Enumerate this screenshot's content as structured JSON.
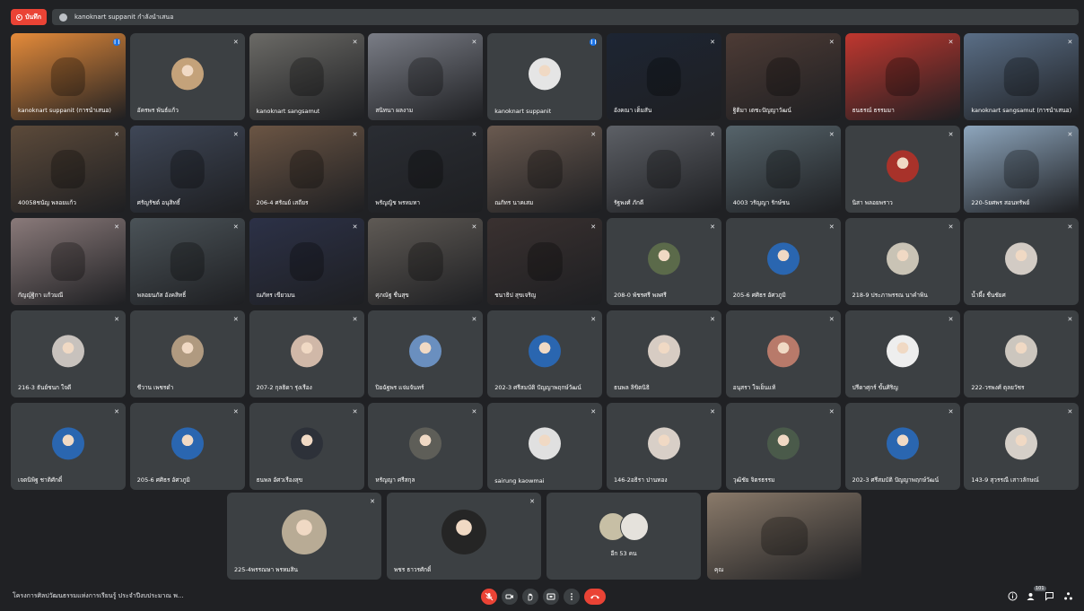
{
  "top": {
    "rec_label": "บันทึก",
    "presenting_text": "kanoknart suppanit กำลังนำเสนอ"
  },
  "tiles": [
    {
      "name": "kanoknart suppanit (การนำเสนอ)",
      "mic": "speaking",
      "kind": "video",
      "color": "#e58b3a"
    },
    {
      "name": "อัครพร พันธ์แก้ว",
      "mic": "muted",
      "kind": "avatar",
      "color": "#c4a27a"
    },
    {
      "name": "kanoknart sangsamut",
      "mic": "muted",
      "kind": "video",
      "color": "#6b6a66"
    },
    {
      "name": "สนิทนา ผลงาม",
      "mic": "muted",
      "kind": "video",
      "color": "#7a7d86"
    },
    {
      "name": "kanoknart suppanit",
      "mic": "speaking",
      "kind": "avatar",
      "color": "#e5e5e5"
    },
    {
      "name": "อังคณา เต็มสัน",
      "mic": "muted",
      "kind": "video",
      "color": "#1d2533"
    },
    {
      "name": "ฐิติมา เตชะปัญญาวัฒน์",
      "mic": "muted",
      "kind": "video",
      "color": "#4d3b35"
    },
    {
      "name": "ธนธรณ์ ธรรมมา",
      "mic": "muted",
      "kind": "video",
      "color": "#c0372f"
    },
    {
      "name": "kanoknart sangsamut (การนำเสนอ)",
      "mic": "muted",
      "kind": "video",
      "color": "#5a6e86"
    },
    {
      "name": "40058ชนัญ พลอยแก้ว",
      "mic": "muted",
      "kind": "video",
      "color": "#5c4a3a"
    },
    {
      "name": "ศรัญรัชต์ อนุสิทธิ์",
      "mic": "muted",
      "kind": "video",
      "color": "#3f4757"
    },
    {
      "name": "206-4 ศรัณย์ เสถียร",
      "mic": "muted",
      "kind": "video",
      "color": "#6b5544"
    },
    {
      "name": "พรัญญิช พรหมทา",
      "mic": "muted",
      "kind": "video",
      "color": "#2a2d33"
    },
    {
      "name": "ณภัทร นาคเสม",
      "mic": "muted",
      "kind": "video",
      "color": "#6a5a50"
    },
    {
      "name": "รัฐพงศ์ ภักดี",
      "mic": "muted",
      "kind": "video",
      "color": "#5d6066"
    },
    {
      "name": "4003 วรัญญา รักษ์ชน",
      "mic": "muted",
      "kind": "video",
      "color": "#56646b"
    },
    {
      "name": "นิสา พลอยพราว",
      "mic": "muted",
      "kind": "avatar",
      "color": "#a8322a"
    },
    {
      "name": "220-5ยศพร สอนทรัพย์",
      "mic": "muted",
      "kind": "video",
      "color": "#8ea6bd"
    },
    {
      "name": "กัญญ์ฐิกา แก้วมณี",
      "mic": "muted",
      "kind": "video",
      "color": "#8a7a7a"
    },
    {
      "name": "พลอยนภัส อังคสิทธิ์",
      "mic": "muted",
      "kind": "video",
      "color": "#4b5358"
    },
    {
      "name": "ณภัทร เขียวมน",
      "mic": "muted",
      "kind": "video",
      "color": "#2c3147"
    },
    {
      "name": "ศุภณัฐ ชื่นสุข",
      "mic": "muted",
      "kind": "video",
      "color": "#5f5a55"
    },
    {
      "name": "ชนาธิป สุขเจริญ",
      "mic": "muted",
      "kind": "video",
      "color": "#3a3130"
    },
    {
      "name": "208-0 พัชรศรี พลศรี",
      "mic": "muted",
      "kind": "avatar",
      "color": "#5b6a4a"
    },
    {
      "name": "205-6 ศศิธร อัศวภูมิ",
      "mic": "muted",
      "kind": "avatar",
      "color": "#2a66b0"
    },
    {
      "name": "218-9 ประภาพรรณ นาคำพิน",
      "mic": "muted",
      "kind": "avatar",
      "color": "#c9c3b5"
    },
    {
      "name": "น้ำผึ้ง ชื่นชัยศ",
      "mic": "muted",
      "kind": "avatar",
      "color": "#d2cbc4"
    },
    {
      "name": "216-3 ธันย์ชนก ใจดี",
      "mic": "muted",
      "kind": "avatar",
      "color": "#c8c2bd"
    },
    {
      "name": "ชีวาน เพชรดำ",
      "mic": "muted",
      "kind": "avatar",
      "color": "#b09a80"
    },
    {
      "name": "207-2 กุลธิดา รุ่งเรือง",
      "mic": "muted",
      "kind": "avatar",
      "color": "#d0b8a8"
    },
    {
      "name": "ปิยฉัฐพร แจ่มจันทร์",
      "mic": "muted",
      "kind": "avatar",
      "color": "#6a8fbf"
    },
    {
      "name": "202-3 ศรีสมบัติ ปัญญาพฤกษ์วัฒน์",
      "mic": "muted",
      "kind": "avatar",
      "color": "#2a66b0"
    },
    {
      "name": "ธนพล ลิขิตนิธิ",
      "mic": "muted",
      "kind": "avatar",
      "color": "#d7ccc3"
    },
    {
      "name": "อนุสรา ใจเย็นแท้",
      "mic": "muted",
      "kind": "avatar",
      "color": "#b87a6a"
    },
    {
      "name": "ปรีดาศุกร์ ขั้นศิริญ",
      "mic": "muted",
      "kind": "avatar",
      "color": "#eeeeee"
    },
    {
      "name": "222-วรพงศ์ ตุลยวัชร",
      "mic": "muted",
      "kind": "avatar",
      "color": "#ccc6be"
    },
    {
      "name": "เจตนิพิฐ ชาติศักดิ์",
      "mic": "muted",
      "kind": "avatar",
      "color": "#2a66b0"
    },
    {
      "name": "205-6 ศศิธร อัศวภูมิ",
      "mic": "muted",
      "kind": "avatar",
      "color": "#2a66b0"
    },
    {
      "name": "ธนพล อัศวเรืองสุข",
      "mic": "muted",
      "kind": "avatar",
      "color": "#2d3139"
    },
    {
      "name": "หรัญญา ศรีสกุล",
      "mic": "muted",
      "kind": "avatar",
      "color": "#5e5e58"
    },
    {
      "name": "sairung kaowmai",
      "mic": "muted",
      "kind": "avatar",
      "color": "#e0e0e0"
    },
    {
      "name": "146-2อธิรา ปานทอง",
      "mic": "muted",
      "kind": "avatar",
      "color": "#d8cfc7"
    },
    {
      "name": "วุฒิชัย จิตรธรรม",
      "mic": "muted",
      "kind": "avatar",
      "color": "#4a5a4a"
    },
    {
      "name": "202-3 ศรีสมบัติ ปัญญาพฤกษ์วัฒน์",
      "mic": "muted",
      "kind": "avatar",
      "color": "#2a66b0"
    },
    {
      "name": "143-9 สุวรรณี เสาวลักษณ์",
      "mic": "muted",
      "kind": "avatar",
      "color": "#d5cfc8"
    },
    {
      "name": "225-4พรรณษา พรหมสิน",
      "mic": "muted",
      "kind": "avatar",
      "color": "#b8ab95"
    },
    {
      "name": "พชร ธาวรศักดิ์",
      "mic": "muted",
      "kind": "avatar",
      "color": "#252525"
    },
    {
      "name": "อีก 53 คน",
      "mic": "",
      "kind": "group",
      "color": "#c7bfa5"
    },
    {
      "name": "คุณ",
      "mic": "",
      "kind": "video",
      "color": "#8a7a6a"
    }
  ],
  "bottom": {
    "meeting_title": "โครงการศิลปวัฒนธรรมแห่งการเรียนรู้ ประจำปีงบประมาณ พ...",
    "people_count": "101",
    "icons": {
      "mic": "mic-off-icon",
      "camera": "camera-icon",
      "hand": "raise-hand-icon",
      "present": "present-icon",
      "more": "more-icon",
      "leave": "hangup-icon",
      "info": "info-icon",
      "people": "people-icon",
      "chat": "chat-icon",
      "activities": "activities-icon"
    }
  }
}
